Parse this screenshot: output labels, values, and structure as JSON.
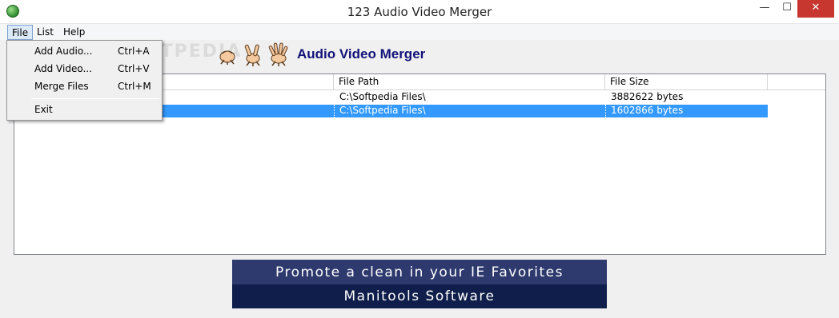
{
  "window": {
    "title": "123 Audio Video Merger",
    "min_glyph": "—",
    "max_glyph": "☐",
    "close_glyph": "✕",
    "icon": "globe-app-icon"
  },
  "menubar": {
    "file": "File",
    "list": "List",
    "help": "Help"
  },
  "file_menu": {
    "items": [
      {
        "label": "Add Audio...",
        "shortcut": "Ctrl+A"
      },
      {
        "label": "Add Video...",
        "shortcut": "Ctrl+V"
      },
      {
        "label": "Merge Files",
        "shortcut": "Ctrl+M"
      },
      {
        "label": "Exit",
        "shortcut": ""
      }
    ]
  },
  "header": {
    "title": "Audio Video Merger",
    "icons": [
      "rock-hand-icon",
      "scissors-hand-icon",
      "paper-hand-icon"
    ]
  },
  "watermark": "SOFTPEDIA",
  "table": {
    "columns": [
      "",
      "File Path",
      "File Size",
      ""
    ],
    "rows": [
      {
        "name": "",
        "path": "C:\\Softpedia Files\\",
        "size": "3882622 bytes"
      },
      {
        "name": "",
        "path": "C:\\Softpedia Files\\",
        "size": "1602866 bytes"
      }
    ],
    "selected_row": 1
  },
  "banner": {
    "line1": "Promote a clean in your IE Favorites",
    "line2": "Manitools Software"
  },
  "colors": {
    "selection": "#3399ff",
    "header_title": "#12127a",
    "banner_top": "#2e3a6e",
    "banner_bottom": "#0f1e4a",
    "close_button": "#c7372f"
  }
}
